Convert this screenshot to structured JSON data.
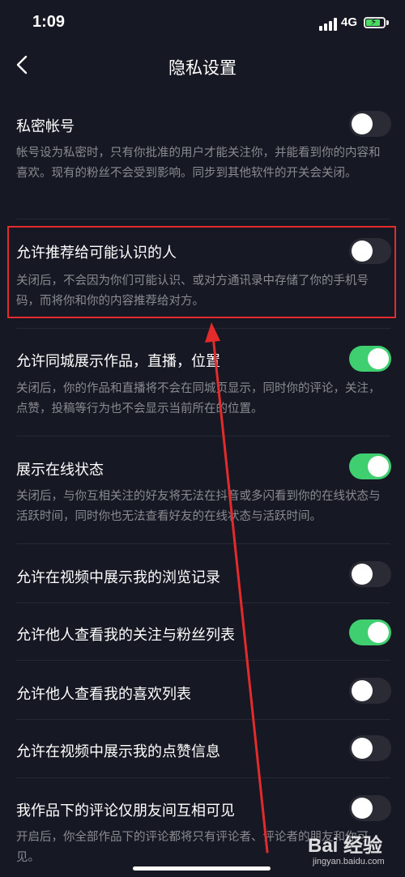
{
  "status_bar": {
    "time": "1:09",
    "network": "4G"
  },
  "nav": {
    "title": "隐私设置",
    "back_icon": "chevron-left-icon"
  },
  "settings": [
    {
      "title": "私密帐号",
      "enabled": false,
      "desc": "帐号设为私密时，只有你批准的用户才能关注你，并能看到你的内容和喜欢。现有的粉丝不会受到影响。同步到其他软件的开关会关闭。"
    },
    {
      "title": "允许推荐给可能认识的人",
      "enabled": false,
      "desc": "关闭后，不会因为你们可能认识、或对方通讯录中存储了你的手机号码，而将你和你的内容推荐给对方。"
    },
    {
      "title": "允许同城展示作品，直播，位置",
      "enabled": true,
      "desc": "关闭后，你的作品和直播将不会在同城页显示，同时你的评论，关注，点赞，投稿等行为也不会显示当前所在的位置。"
    },
    {
      "title": "展示在线状态",
      "enabled": true,
      "desc": "关闭后，与你互相关注的好友将无法在抖音或多闪看到你的在线状态与活跃时间，同时你也无法查看好友的在线状态与活跃时间。"
    },
    {
      "title": "允许在视频中展示我的浏览记录",
      "enabled": false
    },
    {
      "title": "允许他人查看我的关注与粉丝列表",
      "enabled": true
    },
    {
      "title": "允许他人查看我的喜欢列表",
      "enabled": false
    },
    {
      "title": "允许在视频中展示我的点赞信息",
      "enabled": false
    },
    {
      "title": "我作品下的评论仅朋友间互相可见",
      "enabled": false,
      "desc": "开启后，你全部作品下的评论都将只有评论者、评论者的朋友和你可见。"
    }
  ],
  "watermark": {
    "main": "Bai 经验",
    "sub": "jingyan.baidu.com"
  },
  "colors": {
    "background": "#161823",
    "toggle_on": "#3fcf71",
    "toggle_off": "#2a2b35",
    "annotation": "#e42b2b"
  }
}
